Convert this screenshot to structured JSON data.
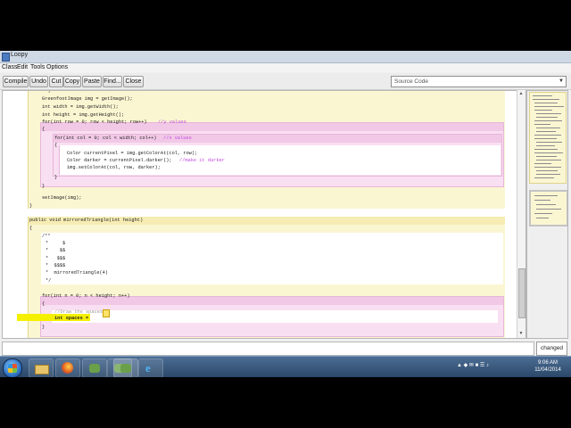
{
  "window": {
    "title": "Loopy"
  },
  "menu": [
    "Class",
    "Edit",
    "Tools",
    "Options"
  ],
  "toolbar": {
    "buttons": [
      "Compile",
      "Undo",
      "Cut",
      "Copy",
      "Paste",
      "Find...",
      "Close"
    ]
  },
  "view_select": {
    "value": "Source Code"
  },
  "code": {
    "l0": "*/",
    "l1": "GreenfootImage img = getImage();",
    "l2": "int width = img.getWidth();",
    "l3": "int height = img.getHeight();",
    "l4": "for(int row = 0; row < height; row++)",
    "l4c": "//y values",
    "l5": "{",
    "l6": "for(int col = 0; col < width; col++)",
    "l6c": "//x values",
    "l7": "{",
    "l8": "Color currentPixel = img.getColorAt(col, row);",
    "l9": "Color darker = currentPixel.darker();",
    "l9c": "//make it darker",
    "l10": "img.setColorAt(col, row, darker);",
    "l11": "}",
    "l12": "}",
    "l13": "setImage(img);",
    "l14": "}",
    "l15": "public void mirroredTriangle(int height)",
    "l16": "{",
    "d1": "/**",
    "d2": "*     $",
    "d3": "*    $$",
    "d4": "*   $$$",
    "d5": "*  $$$$",
    "d6": "*  mirroredTriangle(4)",
    "d7": "*/",
    "l17": "for(int n = 0; n < height; n++)",
    "l18": "{",
    "l19": "//Draw the spaces",
    "l20": "int spaces = ",
    "l21": "}"
  },
  "status": {
    "text": "",
    "changed_label": "changed"
  },
  "taskbar": {
    "icons": [
      "start-icon",
      "folder-icon",
      "firefox-icon",
      "greenfoot-icon",
      "greenfoot-icon",
      "greenfoot-icon",
      "ie-icon"
    ],
    "tray": "▲ ◆ ✉ ■ ☰ ♪",
    "time": "9:06 AM",
    "date": "11/04/2014"
  }
}
